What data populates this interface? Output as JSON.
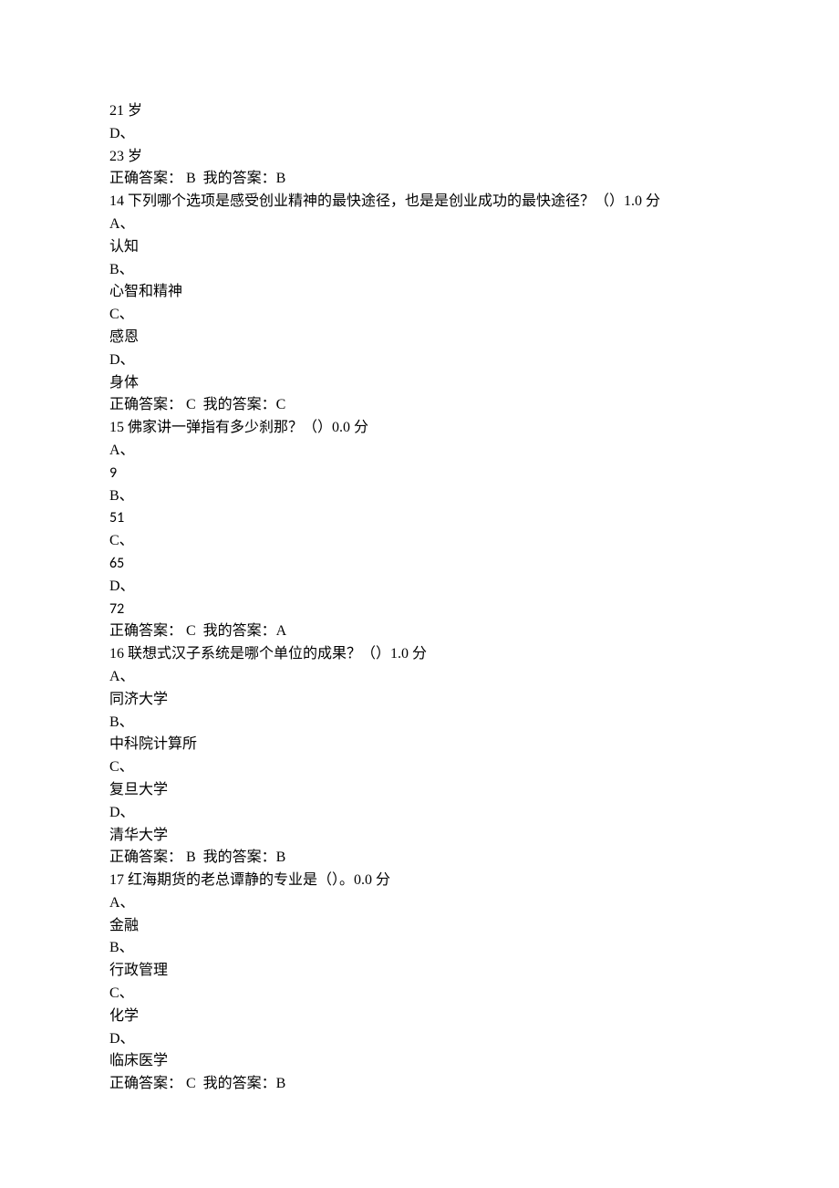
{
  "lines": [
    {
      "text": "21 岁"
    },
    {
      "text": "D、"
    },
    {
      "text": "23 岁"
    },
    {
      "text": "正确答案： B  我的答案：B"
    },
    {
      "text": "14 下列哪个选项是感受创业精神的最快途径，也是是创业成功的最快途径？（）1.0 分"
    },
    {
      "text": "A、"
    },
    {
      "text": "认知"
    },
    {
      "text": "B、"
    },
    {
      "text": "心智和精神"
    },
    {
      "text": "C、"
    },
    {
      "text": "感恩"
    },
    {
      "text": "D、"
    },
    {
      "text": "身体"
    },
    {
      "text": "正确答案： C  我的答案：C"
    },
    {
      "text": "15 佛家讲一弹指有多少刹那？（）0.0 分"
    },
    {
      "text": "A、"
    },
    {
      "text": "9"
    },
    {
      "text": "B、"
    },
    {
      "text": "51"
    },
    {
      "text": "C、"
    },
    {
      "text": "65"
    },
    {
      "text": "D、"
    },
    {
      "text": "72"
    },
    {
      "text": "正确答案： C  我的答案：A"
    },
    {
      "text": "16 联想式汉子系统是哪个单位的成果？（）1.0 分"
    },
    {
      "text": "A、"
    },
    {
      "text": "同济大学"
    },
    {
      "text": "B、"
    },
    {
      "text": "中科院计算所"
    },
    {
      "text": "C、"
    },
    {
      "text": "复旦大学"
    },
    {
      "text": "D、"
    },
    {
      "text": "清华大学"
    },
    {
      "text": "正确答案： B  我的答案：B"
    },
    {
      "text": "17 红海期货的老总谭静的专业是（）。0.0 分"
    },
    {
      "text": "A、"
    },
    {
      "text": "金融"
    },
    {
      "text": "B、"
    },
    {
      "text": "行政管理"
    },
    {
      "text": "C、"
    },
    {
      "text": "化学"
    },
    {
      "text": "D、"
    },
    {
      "text": "临床医学"
    },
    {
      "text": "正确答案： C  我的答案：B"
    }
  ]
}
